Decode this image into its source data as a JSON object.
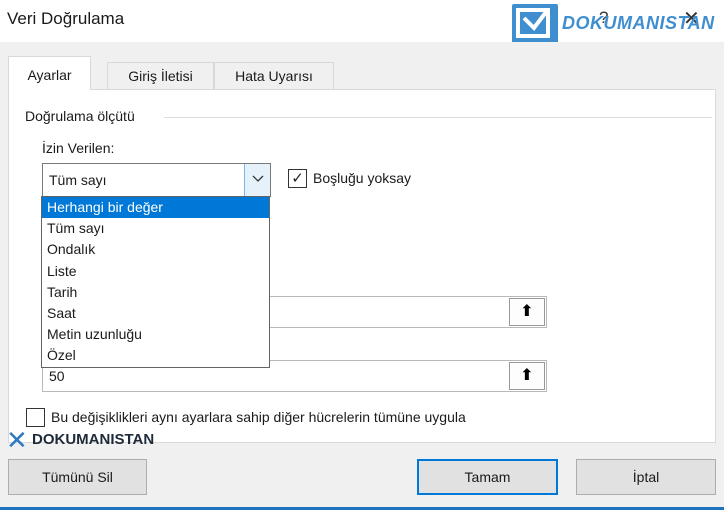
{
  "window": {
    "title": "Veri Doğrulama",
    "help_glyph": "?",
    "close_glyph": "✕"
  },
  "watermark": {
    "top_text": "DOKUMANISTAN",
    "bottom_text": "DOKUMANISTAN"
  },
  "tabs": [
    {
      "label": "Ayarlar",
      "active": true
    },
    {
      "label": "Giriş İletisi",
      "active": false
    },
    {
      "label": "Hata Uyarısı",
      "active": false
    }
  ],
  "settings": {
    "group_title": "Doğrulama ölçütü",
    "allow_label": "İzin Verilen:",
    "allow_value": "Tüm sayı",
    "ignore_blank_label": "Boşluğu yoksay",
    "ignore_blank_checked": true,
    "field1_value": "",
    "field2_value": "50",
    "apply_all_label": "Bu değişiklikleri aynı ayarlara sahip diğer hücrelerin tümüne uygula",
    "apply_all_checked": false
  },
  "dropdown": {
    "options": [
      "Herhangi bir değer",
      "Tüm sayı",
      "Ondalık",
      "Liste",
      "Tarih",
      "Saat",
      "Metin uzunluğu",
      "Özel"
    ],
    "highlighted": "Herhangi bir değer"
  },
  "buttons": {
    "clear_all": "Tümünü Sil",
    "ok": "Tamam",
    "cancel": "İptal"
  },
  "colors": {
    "accent": "#0078d7",
    "watermark_blue": "#3f8ecf"
  }
}
